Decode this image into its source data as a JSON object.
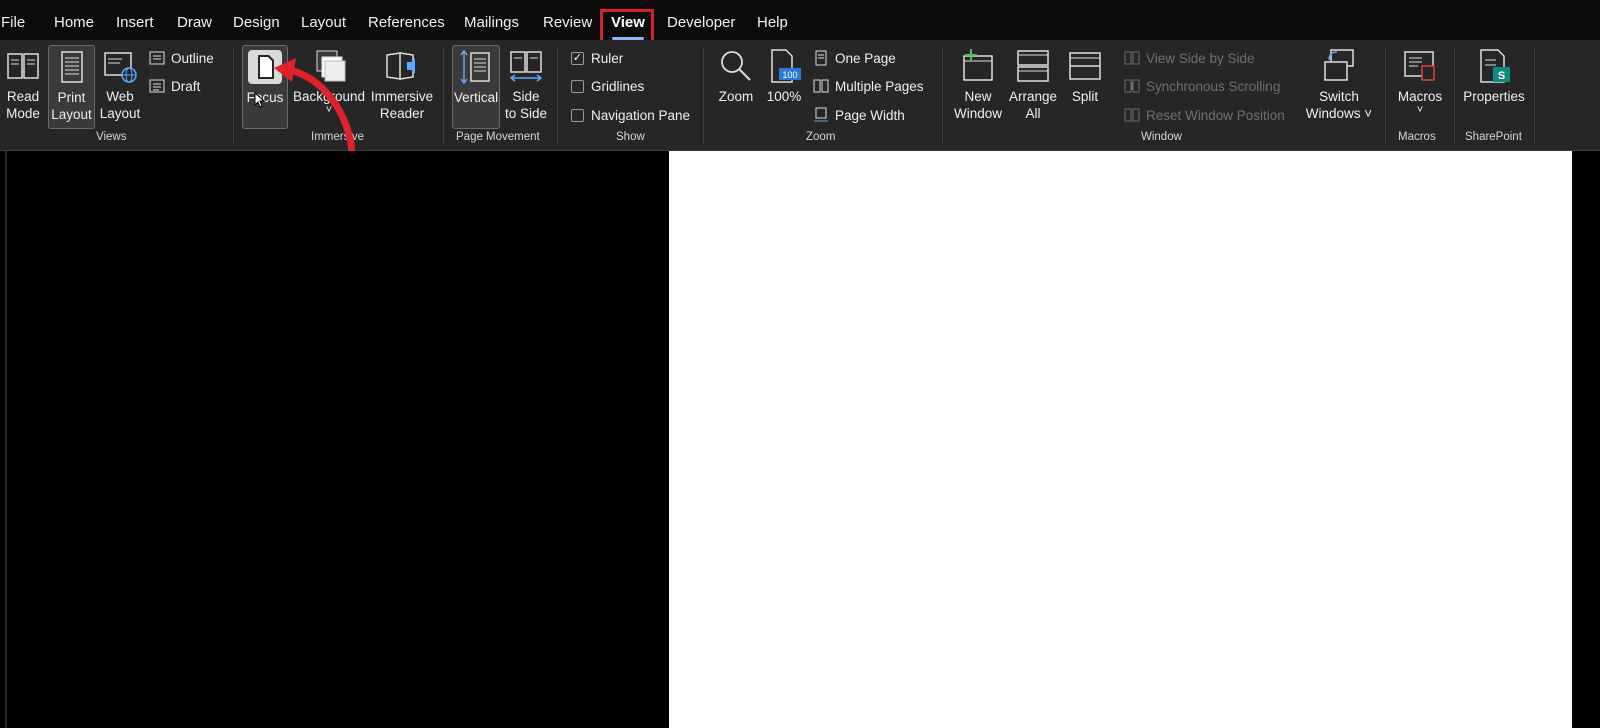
{
  "menu": {
    "tabs": [
      "File",
      "Home",
      "Insert",
      "Draw",
      "Design",
      "Layout",
      "References",
      "Mailings",
      "Review",
      "View",
      "Developer",
      "Help"
    ],
    "active_tab": "View"
  },
  "ribbon": {
    "views": {
      "label": "Views",
      "read_mode": [
        "Read",
        "Mode"
      ],
      "print_layout": [
        "Print",
        "Layout"
      ],
      "web_layout": [
        "Web",
        "Layout"
      ],
      "outline": "Outline",
      "draft": "Draft"
    },
    "immersive": {
      "label": "Immersive",
      "focus": "Focus",
      "background": "Background",
      "immersive_reader": [
        "Immersive",
        "Reader"
      ]
    },
    "page_movement": {
      "label": "Page Movement",
      "vertical": "Vertical",
      "side_to_side": [
        "Side",
        "to Side"
      ]
    },
    "show": {
      "label": "Show",
      "ruler": "Ruler",
      "ruler_checked": true,
      "gridlines": "Gridlines",
      "gridlines_checked": false,
      "navigation_pane": "Navigation Pane",
      "navigation_pane_checked": false
    },
    "zoom": {
      "label": "Zoom",
      "zoom": "Zoom",
      "hundred": "100%",
      "hundred_icon_text": "100",
      "one_page": "One Page",
      "multiple_pages": "Multiple Pages",
      "page_width": "Page Width"
    },
    "window": {
      "label": "Window",
      "new_window": [
        "New",
        "Window"
      ],
      "arrange_all": [
        "Arrange",
        "All"
      ],
      "split": "Split",
      "view_side_by_side": "View Side by Side",
      "synchronous_scrolling": "Synchronous Scrolling",
      "reset_window_position": "Reset Window Position",
      "switch_windows": [
        "Switch",
        "Windows ˅"
      ]
    },
    "macros": {
      "label": "Macros",
      "macros": "Macros",
      "macros_caret": "˅"
    },
    "sharepoint": {
      "label": "SharePoint",
      "properties": "Properties",
      "properties_icon_text": "S"
    }
  },
  "colors": {
    "highlight_box": "#d42027",
    "annotation_arrow": "#e0202a",
    "accent_underline": "#8ab4ff"
  }
}
